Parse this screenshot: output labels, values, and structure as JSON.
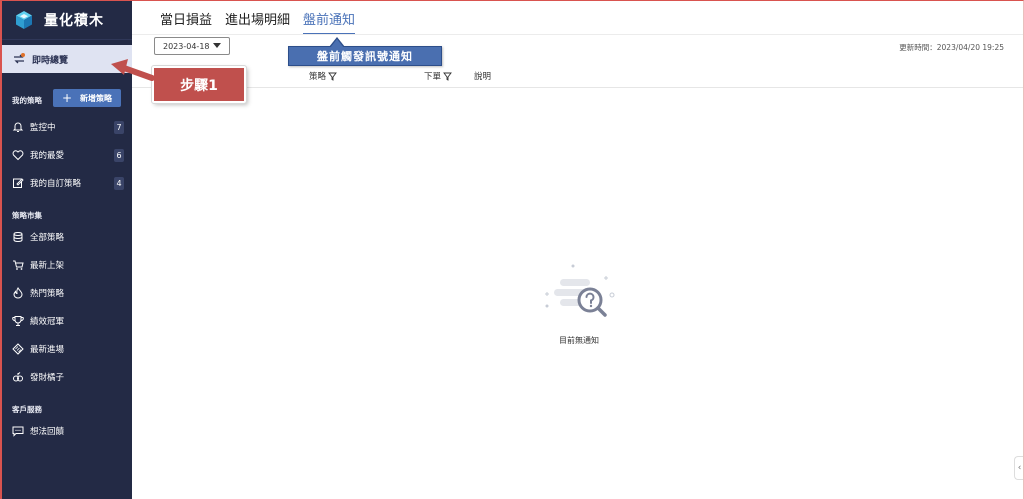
{
  "brand": {
    "name": "量化積木"
  },
  "sidebar": {
    "active_item": "即時總覽",
    "my_strategy": {
      "title": "我的策略",
      "add_button": "新增策略",
      "items": [
        {
          "label": "監控中",
          "count": "7",
          "icon": "bell-icon"
        },
        {
          "label": "我的最愛",
          "count": "6",
          "icon": "heart-icon"
        },
        {
          "label": "我的自訂策略",
          "count": "4",
          "icon": "edit-icon"
        }
      ]
    },
    "market": {
      "title": "策略市集",
      "items": [
        {
          "label": "全部策略",
          "icon": "database-icon"
        },
        {
          "label": "最新上架",
          "icon": "cart-icon"
        },
        {
          "label": "熱門策略",
          "icon": "fire-icon"
        },
        {
          "label": "績效冠軍",
          "icon": "trophy-icon"
        },
        {
          "label": "最新進場",
          "icon": "ticket-icon"
        },
        {
          "label": "發財橘子",
          "icon": "orange-icon"
        }
      ]
    },
    "service": {
      "title": "客戶服務",
      "items": [
        {
          "label": "想法回饋",
          "icon": "message-icon"
        }
      ]
    }
  },
  "tabs": [
    {
      "label": "當日損益",
      "active": false
    },
    {
      "label": "進出場明細",
      "active": false
    },
    {
      "label": "盤前通知",
      "active": true
    }
  ],
  "filter": {
    "date": "2023-04-18"
  },
  "update_time": "更新時間：2023/04/20 19:25",
  "table": {
    "columns": [
      "策略",
      "下單",
      "說明"
    ]
  },
  "empty_state": {
    "text": "目前無通知"
  },
  "annotations": {
    "blue_callout": "盤前觸發訊號通知",
    "red_callout": "步驟1"
  },
  "colors": {
    "sidebar_bg": "#232a45",
    "accent": "#4a72b8",
    "callout_red": "#c0504d",
    "callout_blue": "#4a6fb0"
  }
}
